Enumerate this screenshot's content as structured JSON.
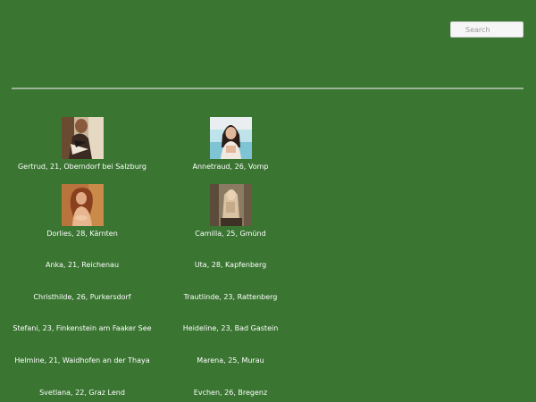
{
  "search": {
    "placeholder": "Search"
  },
  "profiles": [
    {
      "caption": "Gertrud, 21, Oberndorf bei Salzburg",
      "photo": "photo-gertrud"
    },
    {
      "caption": "Annetraud, 26, Vomp",
      "photo": "photo-annetraud"
    },
    {
      "caption": "Dorlies, 28, Kärnten",
      "photo": "photo-dorlies"
    },
    {
      "caption": "Camilla, 25, Gmünd",
      "photo": "photo-camilla"
    },
    {
      "caption": "Anka, 21, Reichenau"
    },
    {
      "caption": "Uta, 28, Kapfenberg"
    },
    {
      "caption": "Christhilde, 26, Purkersdorf"
    },
    {
      "caption": "Trautlinde, 23, Rattenberg"
    },
    {
      "caption": "Stefani, 23, Finkenstein am Faaker See"
    },
    {
      "caption": "Heideline, 23, Bad Gastein"
    },
    {
      "caption": "Helmine, 21, Waidhofen an der Thaya"
    },
    {
      "caption": "Marena, 25, Murau"
    },
    {
      "caption": "Svetlana, 22, Graz Lend"
    },
    {
      "caption": "Evchen, 26, Bregenz"
    }
  ]
}
